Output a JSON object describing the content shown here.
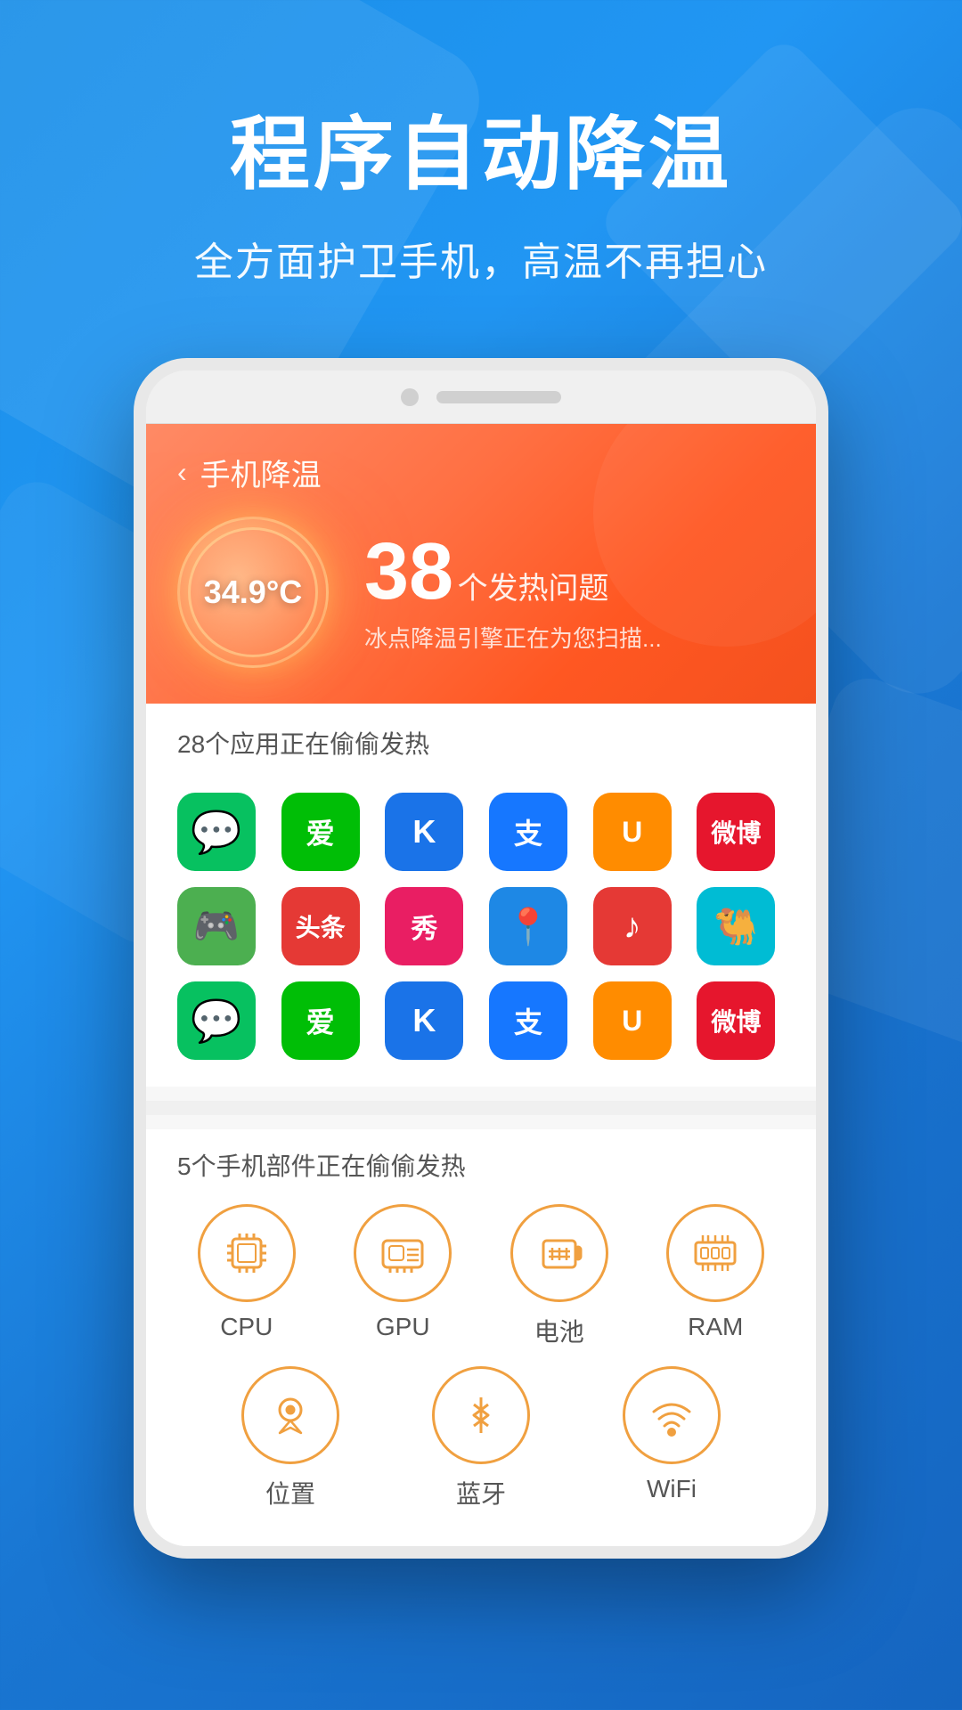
{
  "header": {
    "main_title": "程序自动降温",
    "sub_title": "全方面护卫手机，高温不再担心"
  },
  "app": {
    "nav": {
      "back_label": "‹",
      "title": "手机降温"
    },
    "temperature": {
      "value": "34.9°C",
      "issue_count": "38",
      "issue_label": "个发热问题",
      "scan_desc": "冰点降温引擎正在为您扫描..."
    },
    "apps_section": {
      "label": "28个应用正在偷偷发热",
      "apps_row1": [
        {
          "name": "微信",
          "color": "#07c160",
          "emoji": "💬"
        },
        {
          "name": "爱奇艺",
          "color": "#00be06",
          "emoji": "▶"
        },
        {
          "name": "酷狗",
          "color": "#1a73e8",
          "emoji": "K"
        },
        {
          "name": "支付宝",
          "color": "#1677ff",
          "emoji": "支"
        },
        {
          "name": "UC",
          "color": "#ff6600",
          "emoji": "U"
        },
        {
          "name": "微博",
          "color": "#e6162d",
          "emoji": "微"
        }
      ],
      "apps_row2": [
        {
          "name": "游戏",
          "color": "#4caf50",
          "emoji": "🎮"
        },
        {
          "name": "头条",
          "color": "#e53935",
          "emoji": "头"
        },
        {
          "name": "秀",
          "color": "#e91e63",
          "emoji": "秀"
        },
        {
          "name": "高德",
          "color": "#1565c0",
          "emoji": "📍"
        },
        {
          "name": "网易",
          "color": "#e53935",
          "emoji": "♪"
        },
        {
          "name": "骆驼",
          "color": "#00bcd4",
          "emoji": "🐪"
        }
      ],
      "apps_row3": [
        {
          "name": "微信",
          "color": "#07c160",
          "emoji": "💬"
        },
        {
          "name": "爱奇艺",
          "color": "#00be06",
          "emoji": "▶"
        },
        {
          "name": "酷狗",
          "color": "#1a73e8",
          "emoji": "K"
        },
        {
          "name": "支付宝",
          "color": "#1677ff",
          "emoji": "支"
        },
        {
          "name": "UC",
          "color": "#ff6600",
          "emoji": "U"
        },
        {
          "name": "微博",
          "color": "#e6162d",
          "emoji": "微"
        }
      ]
    },
    "hardware_section": {
      "label": "5个手机部件正在偷偷发热",
      "row1": [
        {
          "name": "CPU",
          "icon": "cpu"
        },
        {
          "name": "GPU",
          "icon": "gpu"
        },
        {
          "name": "电池",
          "icon": "battery"
        },
        {
          "name": "RAM",
          "icon": "ram"
        }
      ],
      "row2": [
        {
          "name": "位置",
          "icon": "location"
        },
        {
          "name": "蓝牙",
          "icon": "bluetooth"
        },
        {
          "name": "WiFi",
          "icon": "wifi"
        }
      ]
    }
  },
  "colors": {
    "blue_gradient_start": "#1a8fe8",
    "blue_gradient_end": "#1565C0",
    "orange_gradient_start": "#ff8a65",
    "orange_gradient_end": "#f4511e",
    "hardware_icon_color": "#f0a040"
  }
}
